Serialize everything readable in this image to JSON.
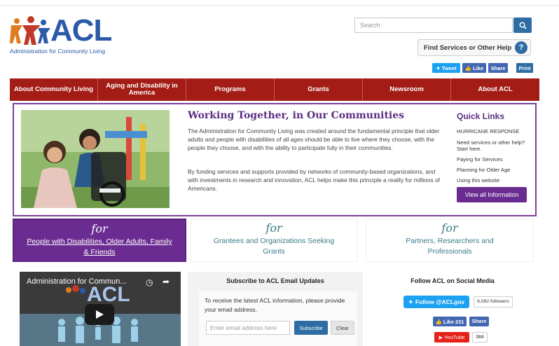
{
  "logo": {
    "word": "ACL",
    "tagline": "Administration for Community Living"
  },
  "search": {
    "placeholder": "Search"
  },
  "find_services": {
    "label": "Find Services or Other Help"
  },
  "share": {
    "tweet": "Tweet",
    "like": "Like",
    "share": "Share",
    "print": "Print"
  },
  "nav": {
    "items": [
      {
        "label": "About Community Living"
      },
      {
        "label": "Aging and Disability in America"
      },
      {
        "label": "Programs"
      },
      {
        "label": "Grants"
      },
      {
        "label": "Newsroom"
      },
      {
        "label": "About ACL"
      }
    ]
  },
  "hero": {
    "title": "Working Together, in Our Communities",
    "p1": "The Administration for Community Living was created around the fundamental principle that older adults and people with disabilities of all ages should be able to live where they choose, with the people they choose, and with the ability to participate fully in their communities.",
    "p2": "By funding services and supports provided by networks of community-based organizations, and with investments in research and innovation, ACL helps make this principle a reality for millions of Americans."
  },
  "quick_links": {
    "title": "Quick Links",
    "items": [
      "HURRICANE RESPONSE",
      "Need services or other help? Start here.",
      "Paying for Services",
      "Planning for Older Age",
      "Using this website"
    ],
    "button": "View all Information"
  },
  "for_boxes": [
    {
      "word": "for",
      "label": "People with Disabilities, Older Adults, Family & Friends"
    },
    {
      "word": "for",
      "label": "Grantees and Organizations Seeking Grants"
    },
    {
      "word": "for",
      "label": "Partners, Researchers and Professionals"
    }
  ],
  "video": {
    "title": "Administration for Commun...",
    "logo_word": "ACL"
  },
  "subscribe": {
    "title": "Subscribe to ACL Email Updates",
    "text": "To receive the latest ACL information, please provide your email address.",
    "placeholder": "Enter email address here",
    "subscribe_label": "Subscribe",
    "clear_label": "Clear"
  },
  "social": {
    "title": "Follow ACL on Social Media",
    "twitter_label": "Follow @ACLgov",
    "followers": "6,082 followers",
    "fb_like": "Like 231",
    "fb_share": "Share",
    "youtube_label": "YouTube",
    "youtube_count": "384"
  },
  "colors": {
    "nav_red": "#a31d16",
    "purple": "#6a2c91",
    "blue": "#2e6da4",
    "logo_blue": "#2a5aa8"
  }
}
